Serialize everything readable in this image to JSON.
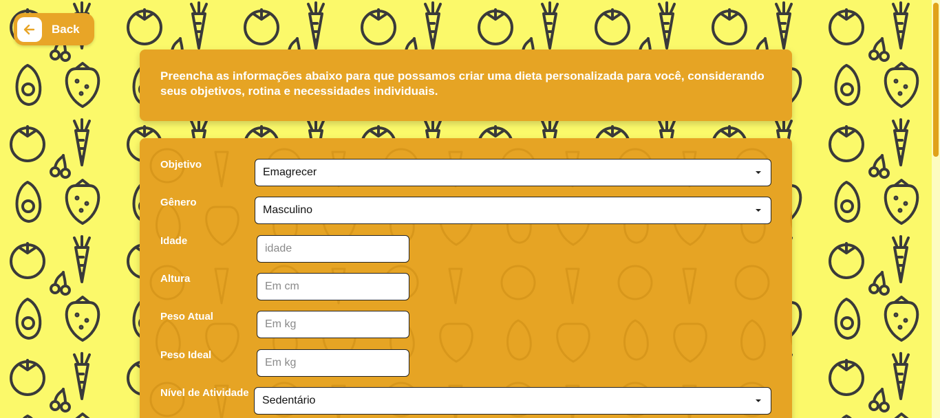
{
  "back_button": {
    "label": "Back",
    "icon": "arrow-left-icon"
  },
  "intro": {
    "text": "Preencha as informações abaixo para que possamos criar uma dieta personalizada para você, considerando seus objetivos, rotina e necessidades individuais."
  },
  "form": {
    "objetivo": {
      "label": "Objetivo",
      "value": "Emagrecer"
    },
    "genero": {
      "label": "Gênero",
      "value": "Masculino"
    },
    "idade": {
      "label": "Idade",
      "placeholder": "idade"
    },
    "altura": {
      "label": "Altura",
      "placeholder": "Em cm"
    },
    "peso_atual": {
      "label": "Peso Atual",
      "placeholder": "Em kg"
    },
    "peso_ideal": {
      "label": "Peso Ideal",
      "placeholder": "Em kg"
    },
    "nivel_atividade": {
      "label": "Nível de Atividade",
      "value": "Sedentário"
    }
  },
  "colors": {
    "background": "#fbf96a",
    "card": "#e6a424",
    "doodle": "#3a3a3a",
    "accent": "#e8a527"
  }
}
